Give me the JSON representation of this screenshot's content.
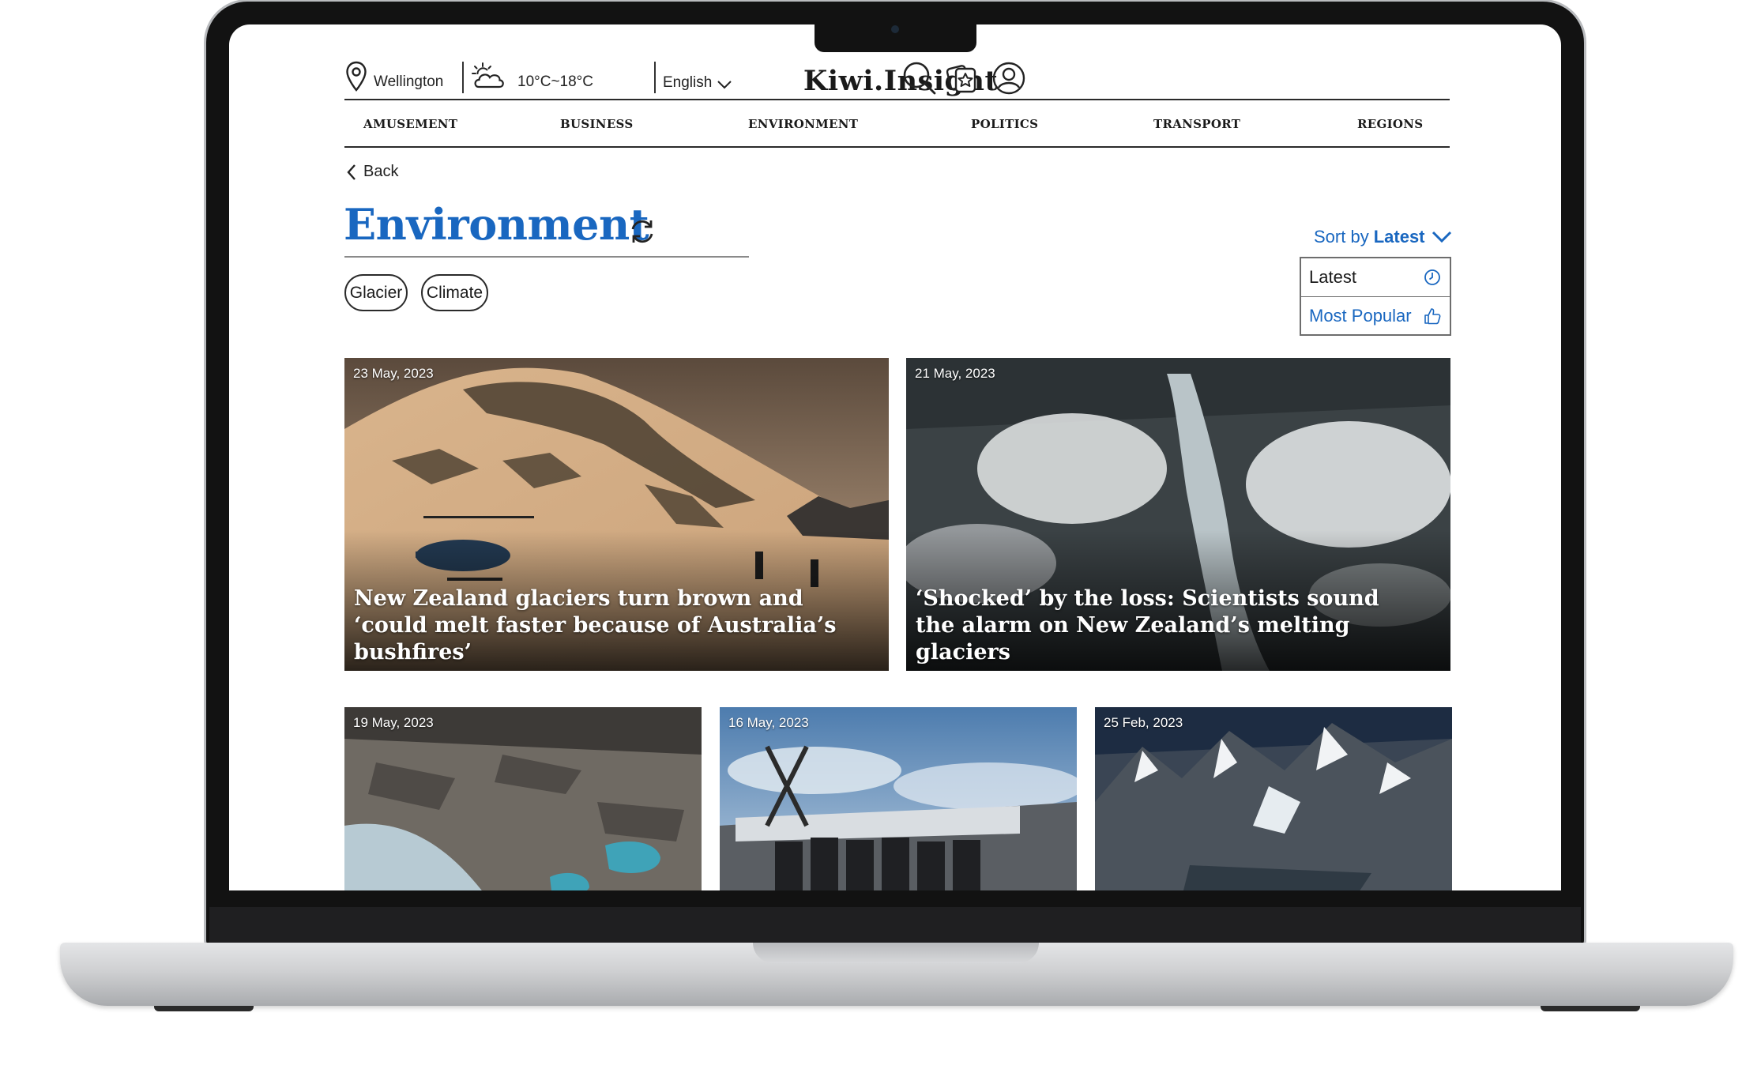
{
  "header": {
    "location": "Wellington",
    "weather": "10°C~18°C",
    "language": "English",
    "logo": "Kiwi.Insight",
    "icons": [
      "location-pin-icon",
      "cloud-sun-icon",
      "chevron-down-icon",
      "search-icon",
      "saved-star-icon",
      "user-profile-icon"
    ]
  },
  "nav": {
    "items": [
      "AMUSEMENT",
      "BUSINESS",
      "ENVIRONMENT",
      "POLITICS",
      "TRANSPORT",
      "REGIONS"
    ]
  },
  "page": {
    "back_label": "Back",
    "title": "Environment",
    "sort_prefix": "Sort by",
    "sort_value": "Latest",
    "sort_options": [
      {
        "label": "Latest",
        "icon": "clock-icon"
      },
      {
        "label": "Most Popular",
        "icon": "thumbs-up-icon"
      }
    ],
    "tags": [
      "Glacier",
      "Climate"
    ]
  },
  "articles": [
    {
      "date": "23 May, 2023",
      "title": "New Zealand glaciers turn brown and ‘could melt faster because of Australia’s bushfires’"
    },
    {
      "date": "21 May, 2023",
      "title": "‘Shocked’ by the loss: Scientists sound the alarm on New Zealand’s melting glaciers"
    },
    {
      "date": "19 May, 2023",
      "title": ""
    },
    {
      "date": "16 May, 2023",
      "title": ""
    },
    {
      "date": "25 Feb, 2023",
      "title": ""
    }
  ],
  "colors": {
    "accent": "#1967c0",
    "text": "#1a1a1a",
    "laptop_bezel": "#121212",
    "laptop_body": "#cfd0d2"
  }
}
